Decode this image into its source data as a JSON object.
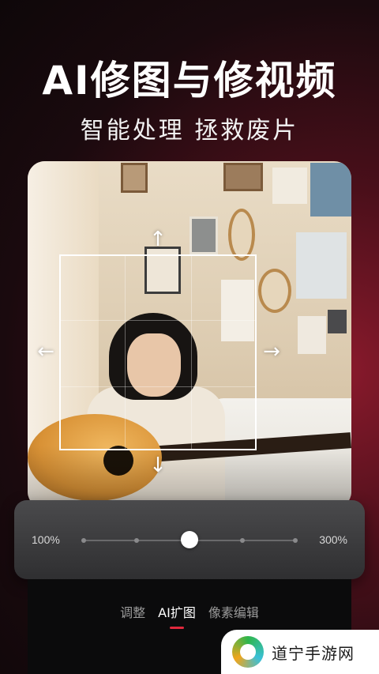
{
  "headline": "AI修图与修视频",
  "subline": "智能处理 拯救废片",
  "crop": {
    "arrows": {
      "up": "↑",
      "down": "↓",
      "left": "←",
      "right": "→"
    }
  },
  "slider": {
    "min_label": "100%",
    "max_label": "300%",
    "value_fraction": 0.5,
    "tick_count": 5
  },
  "tabs": [
    {
      "label": "调整",
      "active": false
    },
    {
      "label": "AI扩图",
      "active": true
    },
    {
      "label": "像素编辑",
      "active": false
    }
  ],
  "watermark": {
    "text": "道宁手游网"
  },
  "colors": {
    "accent": "#e0283c",
    "background": "#1a0a0e",
    "panel": "#3a3a3c"
  }
}
